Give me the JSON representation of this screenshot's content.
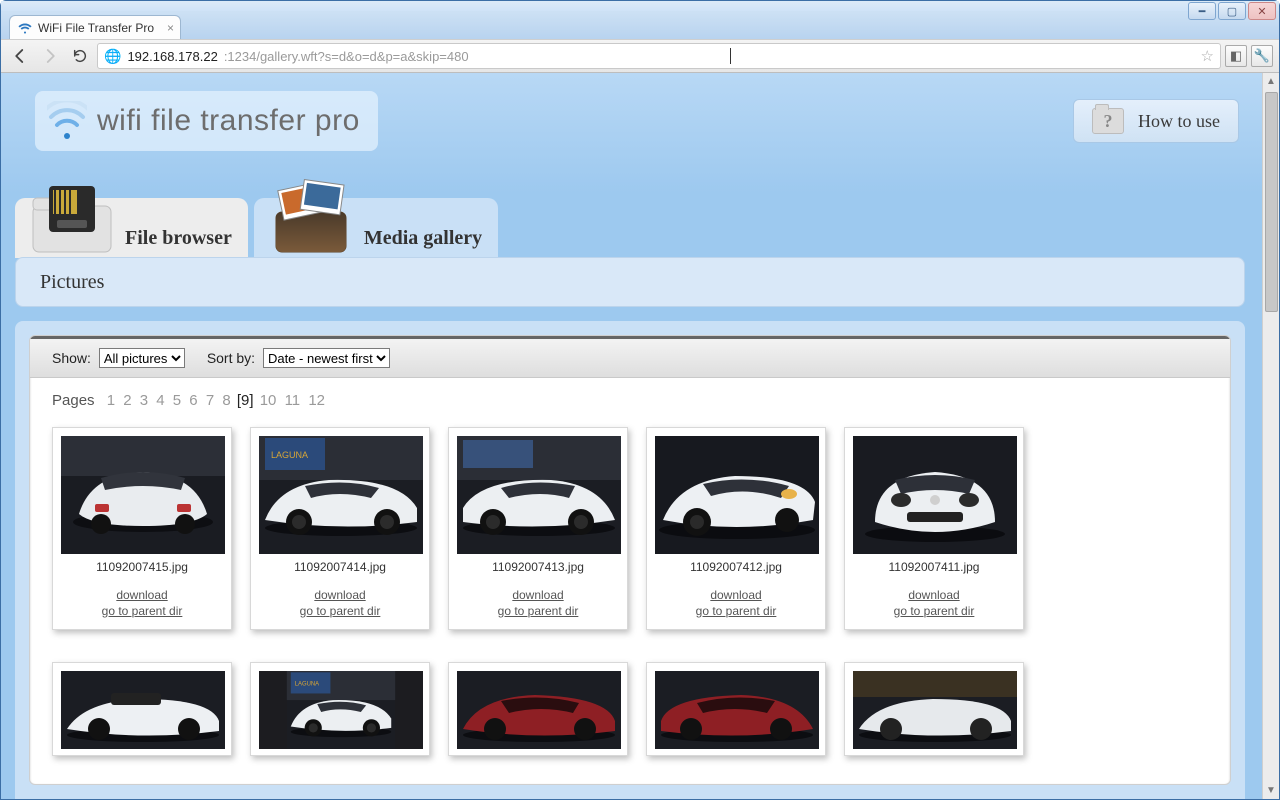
{
  "window": {
    "tab_title": "WiFi File Transfer Pro",
    "url_host": "192.168.178.22",
    "url_rest": ":1234/gallery.wft?s=d&o=d&p=a&skip=480"
  },
  "app": {
    "title": "wifi file transfer pro",
    "howto_label": "How to use"
  },
  "tabs": {
    "file_browser": "File browser",
    "media_gallery": "Media gallery"
  },
  "section": {
    "title": "Pictures"
  },
  "filters": {
    "show_label": "Show:",
    "show_value": "All pictures",
    "sort_label": "Sort by:",
    "sort_value": "Date - newest first"
  },
  "pager": {
    "label": "Pages",
    "pages": [
      "1",
      "2",
      "3",
      "4",
      "5",
      "6",
      "7",
      "8"
    ],
    "current": "[9]",
    "pages_after": [
      "10",
      "11",
      "12"
    ]
  },
  "links": {
    "download": "download",
    "parent": "go to parent dir"
  },
  "row1": [
    {
      "fname": "11092007415.jpg",
      "variant": "rear"
    },
    {
      "fname": "11092007414.jpg",
      "variant": "sideL"
    },
    {
      "fname": "11092007413.jpg",
      "variant": "sideR"
    },
    {
      "fname": "11092007412.jpg",
      "variant": "threeq"
    },
    {
      "fname": "11092007411.jpg",
      "variant": "front"
    }
  ],
  "row2": [
    {
      "variant": "conv"
    },
    {
      "variant": "sideL"
    },
    {
      "variant": "red"
    },
    {
      "variant": "red2"
    },
    {
      "variant": "greenish"
    }
  ]
}
